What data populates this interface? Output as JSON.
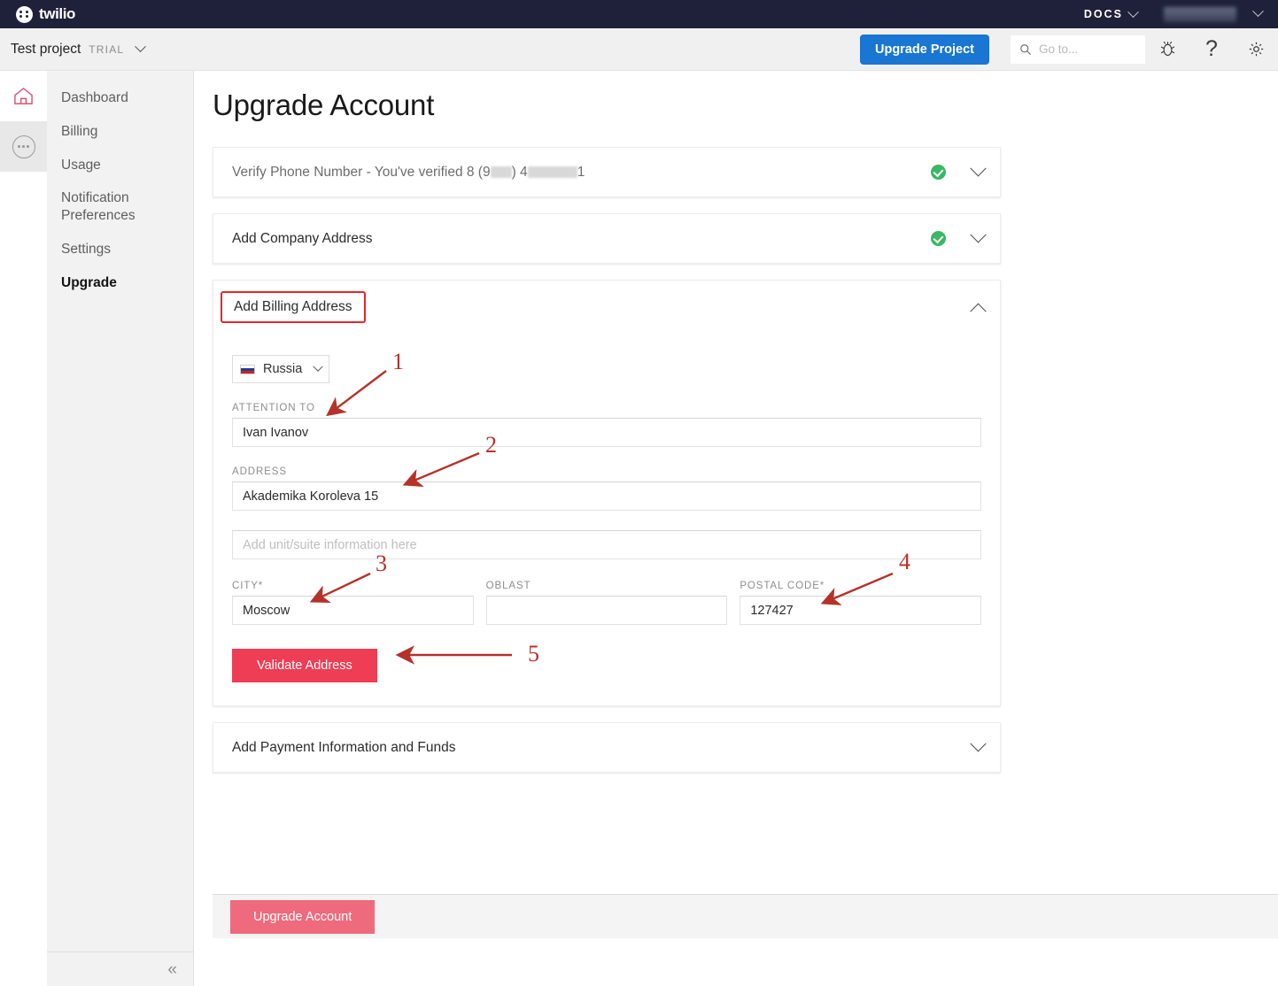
{
  "topbar": {
    "brand": "twilio",
    "docs_label": "DOCS",
    "account_label": "",
    "icons": {
      "chevron": "chevron-down-icon"
    }
  },
  "subbar": {
    "project_name": "Test project",
    "plan_badge": "TRIAL",
    "upgrade_project_button": "Upgrade Project",
    "search_placeholder": "Go to...",
    "search_value": "",
    "icons": [
      "bug-icon",
      "help-icon",
      "gear-icon"
    ]
  },
  "rail": {
    "items": [
      {
        "name": "home-icon",
        "label": "Home"
      },
      {
        "name": "more-icon",
        "label": "More"
      }
    ]
  },
  "sidebar": {
    "items": [
      {
        "label": "Dashboard",
        "active": false
      },
      {
        "label": "Billing",
        "active": false
      },
      {
        "label": "Usage",
        "active": false
      },
      {
        "label": "Notification Preferences",
        "active": false
      },
      {
        "label": "Settings",
        "active": false
      },
      {
        "label": "Upgrade",
        "active": true
      }
    ],
    "collapse_icon": "«"
  },
  "main": {
    "page_title": "Upgrade Account",
    "sections": [
      {
        "id": "verify-phone",
        "title_prefix": "Verify Phone Number - You've verified 8 (9",
        "title_mid": ") 4",
        "title_suffix": "1",
        "completed": true,
        "expanded": false
      },
      {
        "id": "company-address",
        "title": "Add Company Address",
        "completed": true,
        "expanded": false
      },
      {
        "id": "billing-address",
        "title": "Add Billing Address",
        "completed": false,
        "expanded": true,
        "highlighted": true
      },
      {
        "id": "payment-info",
        "title": "Add Payment Information and Funds",
        "completed": false,
        "expanded": false
      }
    ],
    "billing_form": {
      "country": "Russia",
      "country_flag": "flag-russia-icon",
      "attention_label": "ATTENTION TO",
      "attention_value": "Ivan Ivanov",
      "address_label": "ADDRESS",
      "address_value": "Akademika Koroleva 15",
      "unit_placeholder": "Add unit/suite information here",
      "unit_value": "",
      "city_label": "CITY*",
      "city_value": "Moscow",
      "oblast_label": "OBLAST",
      "oblast_value": "",
      "postal_label": "POSTAL CODE*",
      "postal_value": "127427",
      "validate_button": "Validate Address"
    },
    "footer": {
      "upgrade_account_button": "Upgrade Account",
      "disabled": true
    }
  },
  "annotations": {
    "color": "#b5322a",
    "markers": [
      {
        "number": "1",
        "target": "attention-to-input"
      },
      {
        "number": "2",
        "target": "address-input"
      },
      {
        "number": "3",
        "target": "city-input"
      },
      {
        "number": "4",
        "target": "postal-code-input"
      },
      {
        "number": "5",
        "target": "validate-address-button"
      }
    ],
    "highlight_box_color": "#e8252a",
    "highlight_target": "Add Billing Address"
  },
  "colors": {
    "topbar_bg": "#1e2139",
    "primary_blue": "#1976d2",
    "twilio_red": "#ee3d55",
    "success_green": "#3ab863"
  }
}
